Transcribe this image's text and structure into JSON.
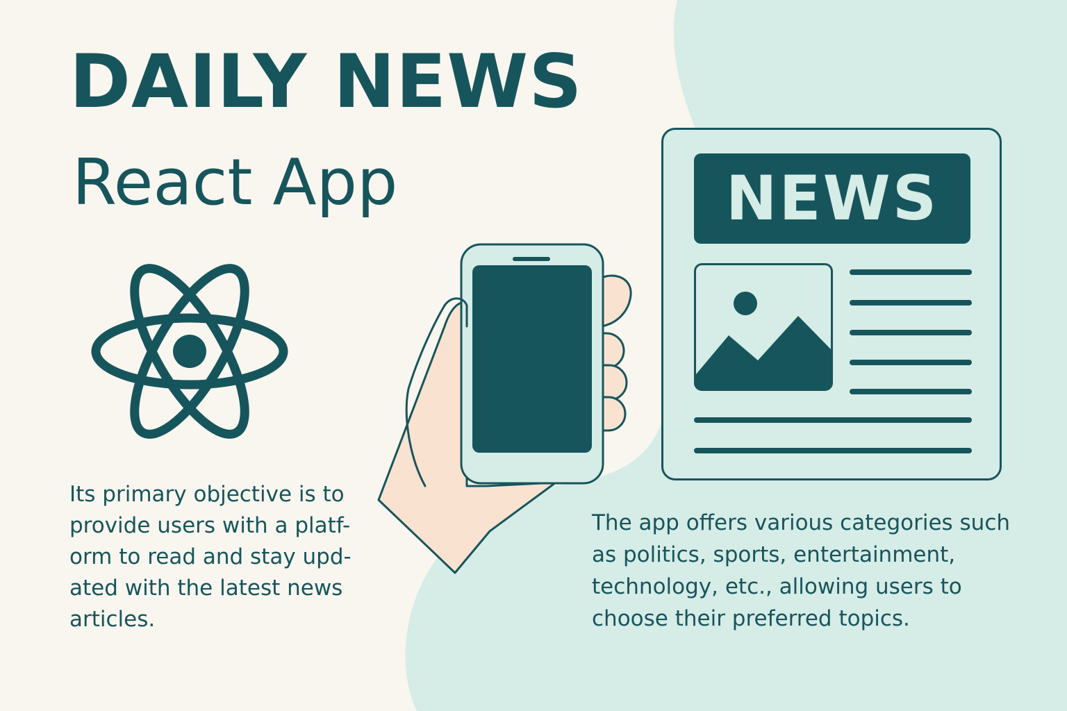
{
  "header": {
    "title": "DAILY NEWS",
    "subtitle": "React App"
  },
  "newspaper": {
    "banner": "NEWS"
  },
  "descriptions": {
    "left": "Its primary objective is to\nprovide users with a platf-\norm to read and stay upd-\nated with the latest news\narticles.",
    "right": "The app offers various categories such\nas politics, sports, entertainment,\ntechnology, etc., allowing users to\nchoose their preferred topics."
  },
  "colors": {
    "primary": "#17555c",
    "mint": "#d6ece6",
    "background": "#f8f6ef",
    "skin": "#f9e2d0"
  },
  "icons": [
    "react-logo-icon",
    "phone-icon",
    "hand-icon",
    "newspaper-icon",
    "image-placeholder-icon"
  ]
}
